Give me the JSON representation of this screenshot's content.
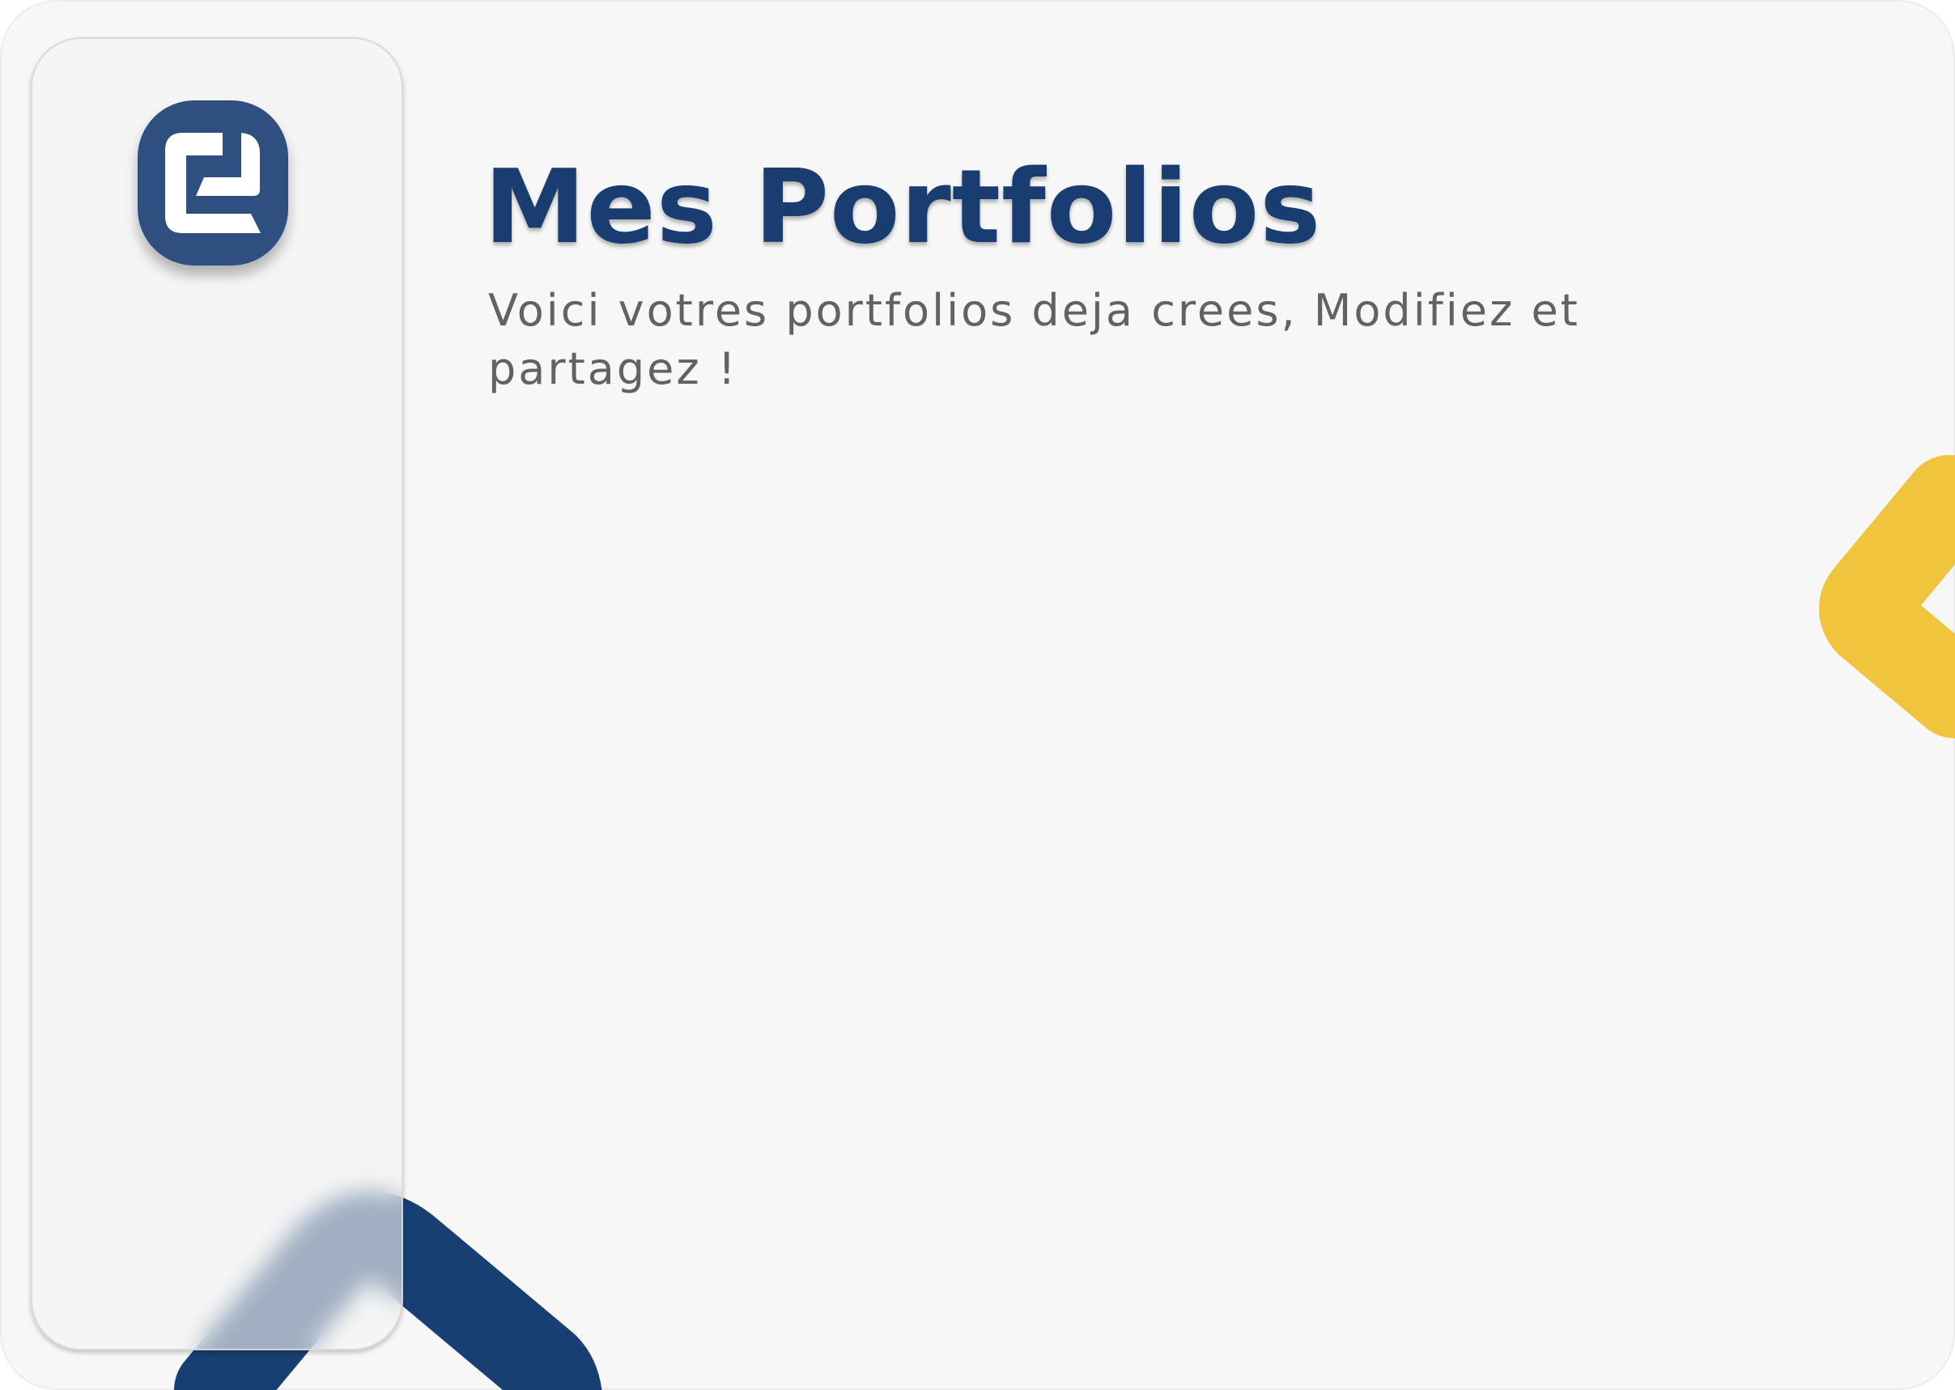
{
  "page": {
    "title": "Mes Portfolios",
    "subtitle": "Voici votres portfolios deja crees, Modifiez et partagez !"
  },
  "sidebar": {
    "logo_icon": "app-logo-icon"
  },
  "colors": {
    "background": "#f7f7f7",
    "title": "#193d71",
    "subtitle": "#626262",
    "logo_background": "#2f4f81",
    "accent_yellow": "#f0c53d",
    "accent_navy": "#183f71"
  }
}
